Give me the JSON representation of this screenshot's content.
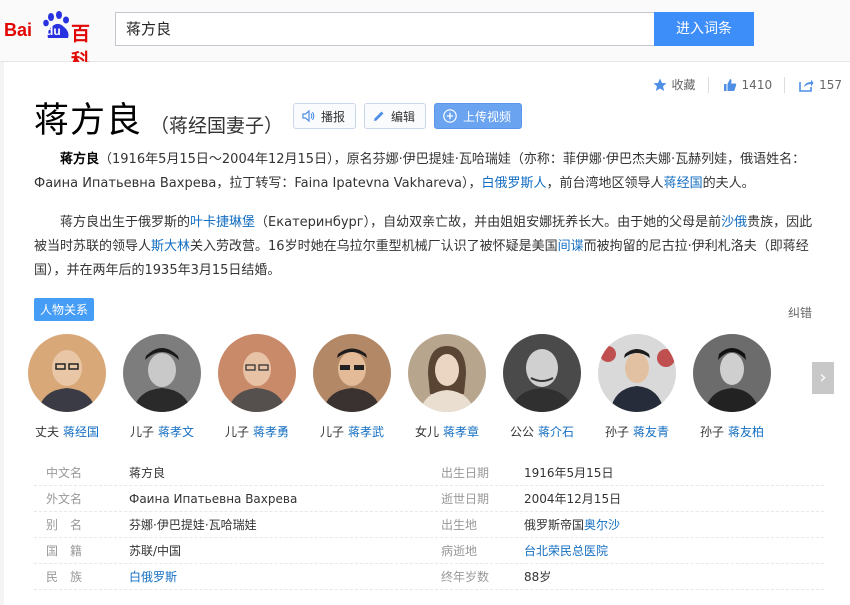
{
  "header": {
    "logo_text_bai": "Bai",
    "logo_text_du": "du",
    "logo_text_baike": "百科",
    "search_value": "蒋方良",
    "search_button": "进入词条"
  },
  "stats": {
    "collect_label": "收藏",
    "like_count": "1410",
    "share_count": "157"
  },
  "title": {
    "name": "蒋方良",
    "subtitle": "（蒋经国妻子）"
  },
  "actions": {
    "broadcast": "播报",
    "edit": "编辑",
    "upload_video": "上传视频"
  },
  "summary": {
    "name_bold": "蒋方良",
    "p1_a": "（1916年5月15日～2004年12月15日），原名芬娜·伊巴提娃·瓦哈瑞娃（亦称：菲伊娜·伊巴杰夫娜·瓦赫列娃，俄语姓名：Фаина Ипатьевна Вахрева，拉丁转写：Faina Ipatevna Vakhareva），",
    "p1_link1": "白俄罗斯人",
    "p1_b": "，前台湾地区领导人",
    "p1_link2": "蒋经国",
    "p1_c": "的夫人。",
    "p2_a": "蒋方良出生于俄罗斯的",
    "p2_link1": "叶卡捷琳堡",
    "p2_b": "（Екатеринбург），自幼双亲亡故，并由姐姐安娜抚养长大。由于她的父母是前",
    "p2_link2": "沙俄",
    "p2_c": "贵族，因此被当时苏联的领导人",
    "p2_link3": "斯大林",
    "p2_d": "关入劳改营。16岁时她在乌拉尔重型机械厂认识了被怀疑是美国",
    "p2_link4": "间谍",
    "p2_e": "而被拘留的尼古拉·伊利札洛夫（即蒋经国），并在两年后的1935年3月15日结婚。"
  },
  "relations": {
    "tag": "人物关系",
    "report": "纠错",
    "people": [
      {
        "relation": "丈夫",
        "name": "蒋经国",
        "bg": "#d8a878",
        "suit": "#3b3b46"
      },
      {
        "relation": "儿子",
        "name": "蒋孝文",
        "bg": "#7d7d7d",
        "suit": "#2a2a2a"
      },
      {
        "relation": "儿子",
        "name": "蒋孝勇",
        "bg": "#c98a6a",
        "suit": "#55504e"
      },
      {
        "relation": "儿子",
        "name": "蒋孝武",
        "bg": "#b28867",
        "suit": "#3a3230"
      },
      {
        "relation": "女儿",
        "name": "蒋孝章",
        "bg": "#b7a58e",
        "suit": "#e9ded0"
      },
      {
        "relation": "公公",
        "name": "蒋介石",
        "bg": "#4a4a4a",
        "suit": "#303030"
      },
      {
        "relation": "孙子",
        "name": "蒋友青",
        "bg": "#c05050",
        "suit": "#272c3a"
      },
      {
        "relation": "孙子",
        "name": "蒋友柏",
        "bg": "#6c6c6c",
        "suit": "#222"
      }
    ]
  },
  "infobox": {
    "rows": [
      {
        "k1": "中文名",
        "v1": "蒋方良",
        "k2": "出生日期",
        "v2": "1916年5月15日"
      },
      {
        "k1": "外文名",
        "v1": "Фаина Ипатьевна Вахрева",
        "k2": "逝世日期",
        "v2": "2004年12月15日"
      },
      {
        "k1": "别　名",
        "v1": "芬娜·伊巴提娃·瓦哈瑞娃",
        "k2": "出生地",
        "v2a": "俄罗斯帝国",
        "v2link": "奥尔沙"
      },
      {
        "k1": "国　籍",
        "v1": "苏联/中国",
        "k2": "病逝地",
        "v2link": "台北荣民总医院"
      },
      {
        "k1": "民　族",
        "v1link": "白俄罗斯",
        "k2": "终年岁数",
        "v2": "88岁"
      }
    ]
  },
  "colors": {
    "brand_red": "#e10602",
    "link_blue": "#136ec2",
    "button_blue": "#3d8ef8"
  }
}
